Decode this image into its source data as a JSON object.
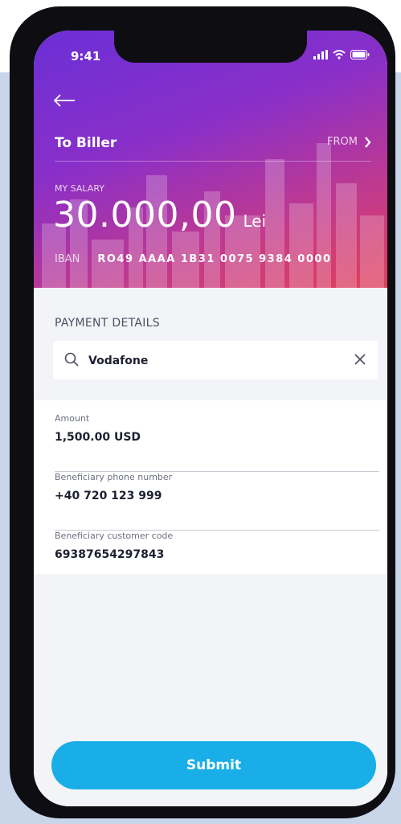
{
  "status_bar": {
    "time": "9:41"
  },
  "header": {
    "title": "To Biller",
    "from_label": "FROM"
  },
  "account": {
    "label": "MY SALARY",
    "amount": "30.000,00",
    "currency": "Lei",
    "iban_label": "IBAN",
    "iban_value": "RO49 AAAA 1B31 0075 9384 0000"
  },
  "payment": {
    "section_title": "PAYMENT DETAILS",
    "search_value": "Vodafone"
  },
  "fields": [
    {
      "label": "Amount",
      "value": "1,500.00 USD"
    },
    {
      "label": "Beneficiary phone number",
      "value": "+40 720 123 999"
    },
    {
      "label": "Beneficiary customer code",
      "value": "69387654297843"
    }
  ],
  "submit_label": "Submit",
  "colors": {
    "gradient_start": "#6b2fd6",
    "gradient_end": "#e0405a",
    "accent": "#1aaee8",
    "background": "#c9d6ea"
  }
}
